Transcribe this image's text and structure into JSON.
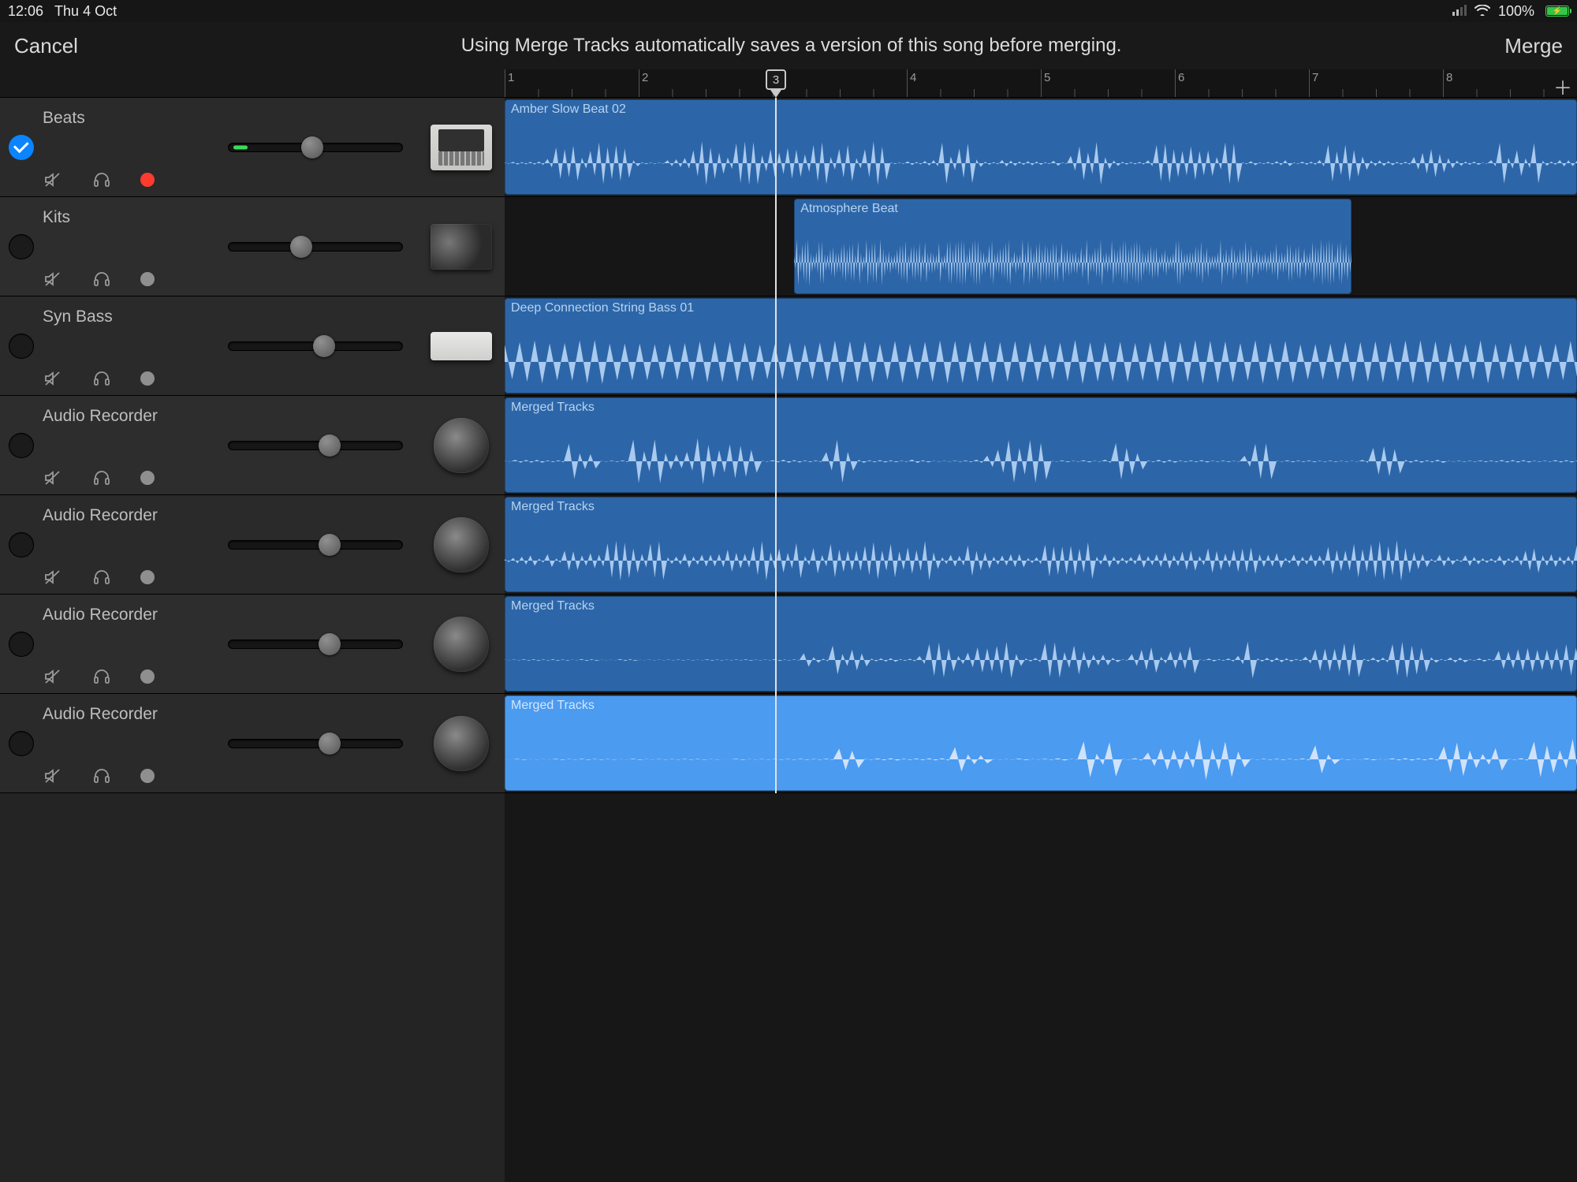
{
  "status": {
    "time": "12:06",
    "date": "Thu 4 Oct",
    "battery_pct": "100%"
  },
  "header": {
    "cancel": "Cancel",
    "message": "Using Merge Tracks automatically saves a version of this song before merging.",
    "merge": "Merge"
  },
  "ruler": {
    "bars": [
      "1",
      "2",
      "3",
      "4",
      "5",
      "6",
      "7",
      "8"
    ]
  },
  "playhead_bar": 3,
  "tracks": [
    {
      "name": "Beats",
      "selected": true,
      "recording": true,
      "volume": 48,
      "level": 8,
      "instrument": "box"
    },
    {
      "name": "Kits",
      "selected": false,
      "recording": false,
      "volume": 42,
      "level": 0,
      "instrument": "drums"
    },
    {
      "name": "Syn Bass",
      "selected": false,
      "recording": false,
      "volume": 55,
      "level": 0,
      "instrument": "synth"
    },
    {
      "name": "Audio Recorder",
      "selected": false,
      "recording": false,
      "volume": 58,
      "level": 0,
      "instrument": "speaker"
    },
    {
      "name": "Audio Recorder",
      "selected": false,
      "recording": false,
      "volume": 58,
      "level": 0,
      "instrument": "speaker"
    },
    {
      "name": "Audio Recorder",
      "selected": false,
      "recording": false,
      "volume": 58,
      "level": 0,
      "instrument": "speaker"
    },
    {
      "name": "Audio Recorder",
      "selected": false,
      "recording": false,
      "volume": 58,
      "level": 0,
      "instrument": "speaker"
    }
  ],
  "regions": [
    {
      "lane": 0,
      "name": "Amber Slow Beat 02",
      "start_pct": 0,
      "width_pct": 100,
      "selected": false,
      "wave": "bursty"
    },
    {
      "lane": 1,
      "name": "Atmosphere Beat",
      "start_pct": 27,
      "width_pct": 52,
      "selected": false,
      "wave": "noisy"
    },
    {
      "lane": 2,
      "name": "Deep Connection String Bass 01",
      "start_pct": 0,
      "width_pct": 100,
      "selected": false,
      "wave": "saw"
    },
    {
      "lane": 3,
      "name": "Merged Tracks",
      "start_pct": 0,
      "width_pct": 100,
      "selected": false,
      "wave": "sparse"
    },
    {
      "lane": 4,
      "name": "Merged Tracks",
      "start_pct": 0,
      "width_pct": 100,
      "selected": false,
      "wave": "dense"
    },
    {
      "lane": 5,
      "name": "Merged Tracks",
      "start_pct": 0,
      "width_pct": 100,
      "selected": false,
      "wave": "mid"
    },
    {
      "lane": 6,
      "name": "Merged Tracks",
      "start_pct": 0,
      "width_pct": 100,
      "selected": true,
      "wave": "sparse2"
    }
  ],
  "colors": {
    "region": "#2d66a8",
    "region_selected": "#4b9bf0",
    "waveform": "#a9caee",
    "accent_blue": "#0a84ff",
    "record_red": "#ff3b30",
    "battery_green": "#33c64a"
  }
}
